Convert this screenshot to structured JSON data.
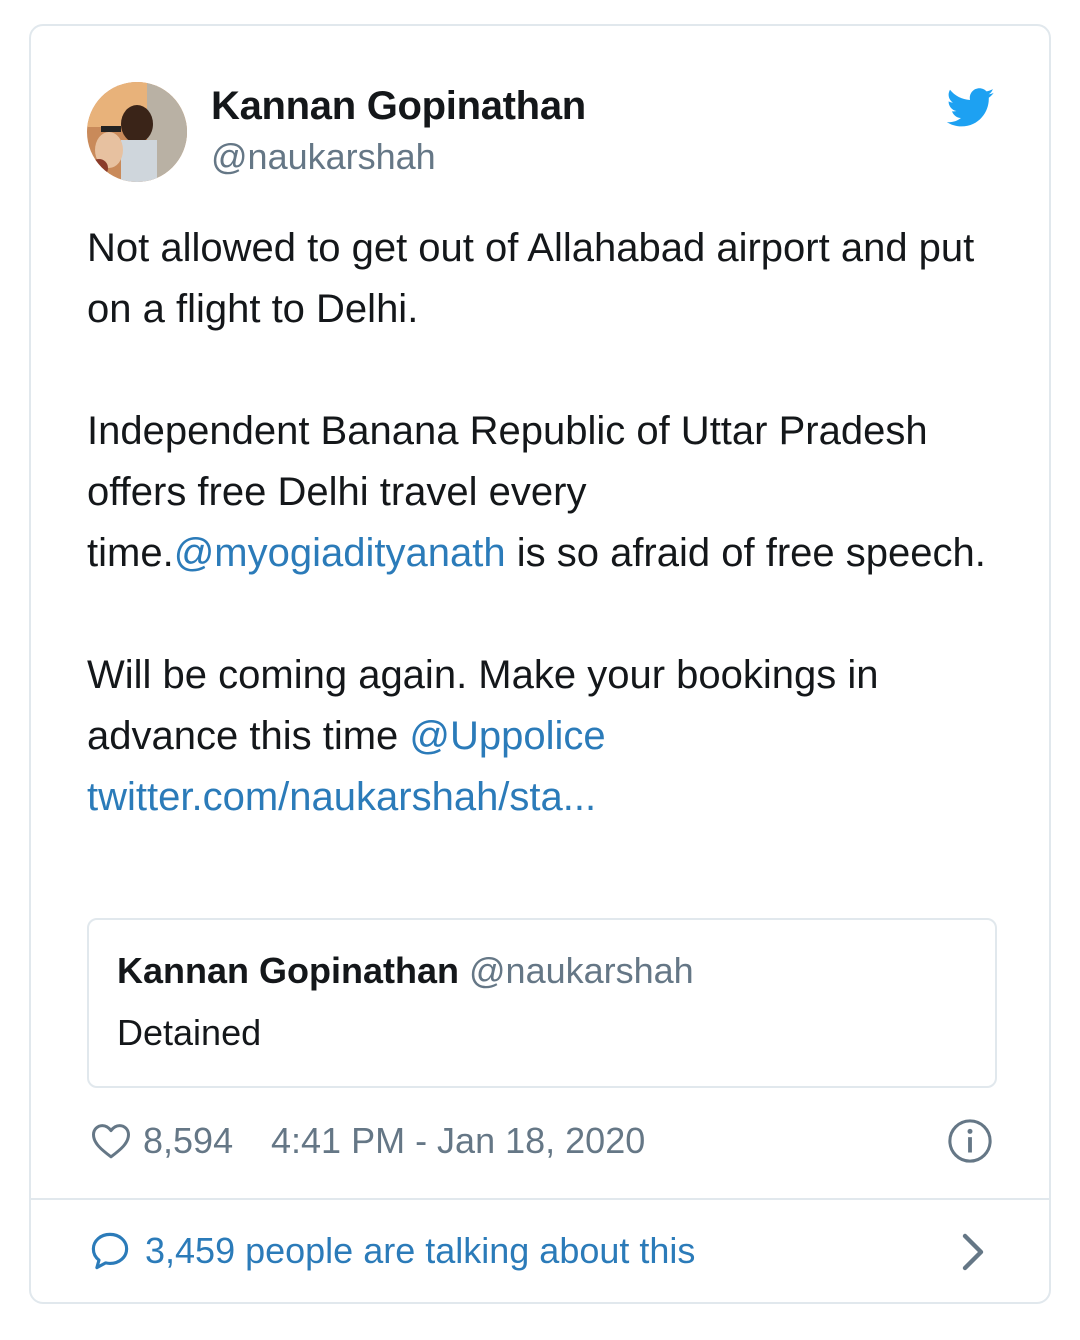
{
  "author": {
    "name": "Kannan Gopinathan",
    "handle": "@naukarshah"
  },
  "tweet": {
    "p1": "Not allowed to get out of Allahabad airport and put on a flight to Delhi.",
    "p2_before": "Independent Banana Republic of Uttar Pradesh offers free Delhi travel every time.",
    "p2_mention": "@myogiadityanath",
    "p2_after": " is so afraid of free speech.",
    "p3_before": "Will be coming again. Make your bookings in advance this time ",
    "p3_mention": "@Uppolice",
    "p3_link": "twitter.com/naukarshah/sta..."
  },
  "quoted_tweet": {
    "name": "Kannan Gopinathan",
    "handle": "@naukarshah",
    "text": "Detained"
  },
  "footer": {
    "likes": "8,594",
    "timestamp": "4:41 PM - Jan 18, 2020",
    "talking": "3,459 people are talking about this"
  },
  "icons": {
    "brand": "twitter-bird-icon",
    "like": "heart-icon",
    "info": "info-icon",
    "reply": "speech-bubble-icon",
    "more": "chevron-right-icon"
  },
  "colors": {
    "brand": "#1da1f2",
    "link": "#2b7bb9",
    "muted": "#657786",
    "text": "#14171a",
    "border": "#e1e8ed"
  }
}
